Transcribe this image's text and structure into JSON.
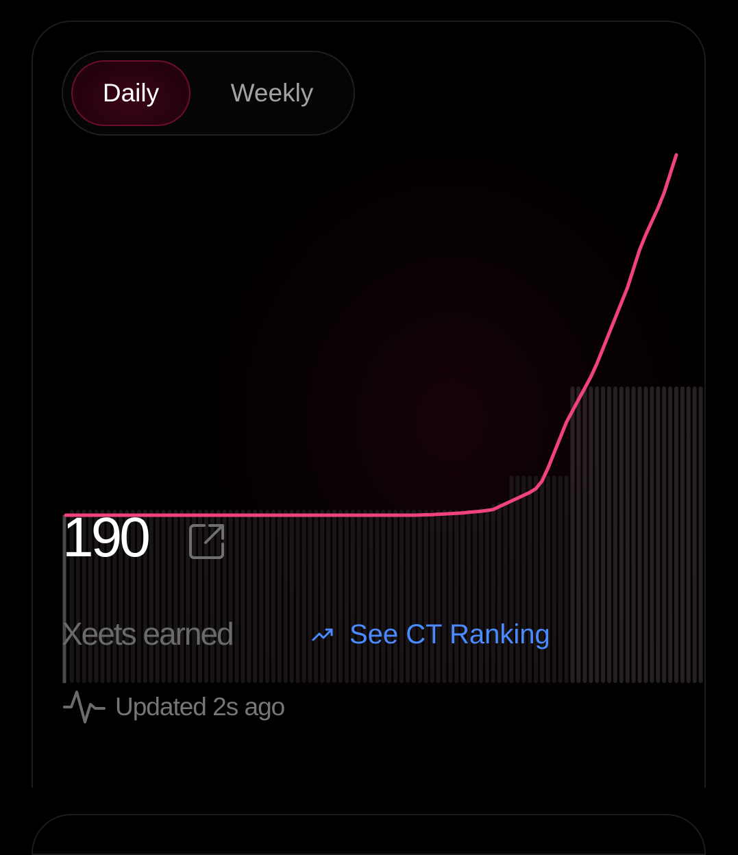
{
  "toggle": {
    "daily_label": "Daily",
    "weekly_label": "Weekly",
    "selected": "Daily"
  },
  "stats": {
    "value": "190",
    "label": "Xeets earned",
    "ranking_link": "See CT Ranking",
    "updated": "Updated 2s ago"
  },
  "colors": {
    "accent": "#f0437e",
    "link": "#4a8bff",
    "background": "#000000",
    "tab_active_border": "#6e0c2e"
  },
  "icons": {
    "external": "external-link-icon",
    "trend": "trending-up-icon",
    "pulse": "activity-pulse-icon"
  },
  "chart_data": {
    "type": "line",
    "x": [
      0,
      1,
      2,
      3,
      4,
      5,
      6,
      7,
      8,
      9,
      10,
      11,
      12,
      13,
      14,
      15,
      16,
      17,
      18,
      19,
      20,
      21,
      22,
      23,
      24,
      25,
      26,
      27,
      28,
      29,
      30,
      31,
      32,
      33,
      34,
      35,
      36,
      37,
      38,
      39,
      40,
      41,
      42,
      43,
      44,
      45,
      46,
      47,
      48,
      49,
      50,
      51,
      52,
      53,
      54,
      55,
      56,
      57,
      58,
      59,
      60,
      61,
      62,
      63,
      64,
      65,
      66,
      67,
      68,
      69,
      70,
      71,
      72,
      73,
      74,
      75,
      76,
      77,
      78,
      79,
      80,
      81,
      82,
      83,
      84,
      85,
      86,
      87,
      88,
      89,
      90,
      91,
      92,
      93,
      94,
      95,
      96,
      97,
      98,
      99,
      100
    ],
    "values": [
      0,
      0,
      0,
      0,
      0,
      0,
      0,
      0,
      0,
      0,
      0,
      0,
      0,
      0,
      0,
      0,
      0,
      0,
      0,
      0,
      0,
      0,
      0,
      0,
      0,
      0,
      0,
      0,
      0,
      0,
      0,
      0,
      0,
      0,
      0,
      0,
      0,
      0,
      0,
      0,
      0,
      0,
      0,
      0,
      0,
      0,
      0,
      0,
      0,
      0,
      0,
      0,
      0,
      0,
      0,
      0,
      0,
      0,
      0.1,
      0.2,
      0.3,
      0.5,
      0.6,
      0.8,
      1.0,
      1.2,
      1.5,
      1.8,
      2.1,
      2.5,
      3.0,
      4.5,
      6.0,
      7.5,
      9.0,
      10.5,
      12.0,
      14.0,
      18.0,
      25.0,
      33.0,
      41.0,
      49.0,
      55.0,
      61.0,
      67.0,
      73.0,
      80.0,
      88.0,
      96.0,
      104.0,
      112.0,
      120.0,
      130.0,
      140.0,
      148.0,
      155.0,
      162.0,
      170.0,
      180.0,
      190.0
    ],
    "bars": [
      0,
      0,
      0,
      0,
      0,
      0,
      0,
      0,
      0,
      0,
      0,
      0,
      0,
      0,
      0,
      0,
      0,
      0,
      0,
      0,
      0,
      0,
      0,
      0,
      0,
      0,
      0,
      0,
      0,
      0,
      0,
      0,
      0,
      0,
      0,
      0,
      0,
      0,
      0,
      0,
      0,
      0,
      0,
      0,
      0,
      0,
      0,
      0,
      0,
      0,
      0,
      0,
      0,
      0,
      0,
      0,
      0,
      0,
      0,
      0,
      0,
      0,
      0,
      0,
      0,
      0,
      0,
      0,
      1,
      1,
      3,
      4,
      4,
      18,
      18,
      18,
      18,
      18,
      18,
      18,
      18,
      18,
      18,
      65,
      65,
      65,
      65,
      65,
      65,
      65,
      65,
      65,
      65,
      65,
      65,
      65,
      65,
      65,
      65,
      65,
      65,
      65,
      65,
      65,
      65
    ],
    "ylim": [
      0,
      190
    ]
  }
}
